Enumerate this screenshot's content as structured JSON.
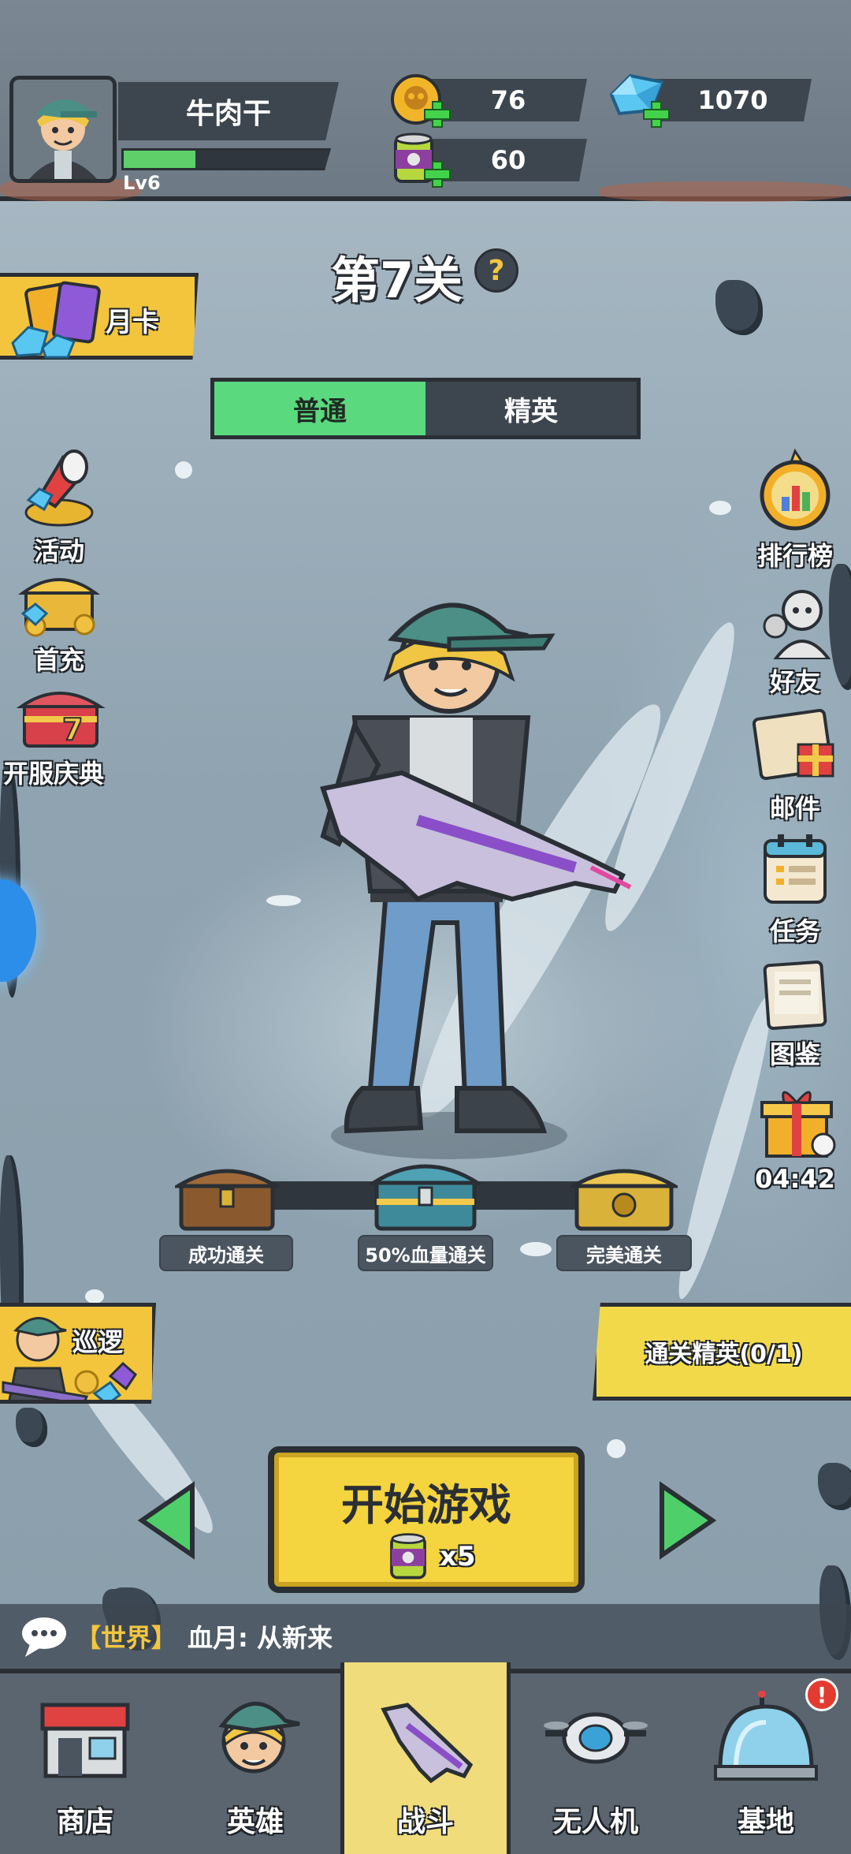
{
  "player": {
    "name": "牛肉干",
    "level": "Lv6",
    "xp_progress": 0.35
  },
  "resources": {
    "skull_coins": "76",
    "gems": "1070",
    "energy_cans": "60"
  },
  "stage": {
    "title": "第7关",
    "help_icon": "?",
    "modes": [
      "普通",
      "精英"
    ],
    "active_mode": "普通"
  },
  "left_menu": {
    "monthly_card": "月卡",
    "items": [
      {
        "label": "活动",
        "icon": "megaphone-coins-icon"
      },
      {
        "label": "首充",
        "icon": "treasure-chest-icon"
      },
      {
        "label": "开服庆典",
        "icon": "red-chest-7-icon"
      }
    ],
    "patrol": "巡逻"
  },
  "right_menu": {
    "items": [
      {
        "label": "排行榜",
        "icon": "trophy-medal-icon"
      },
      {
        "label": "好友",
        "icon": "friends-icon"
      },
      {
        "label": "邮件",
        "icon": "mail-gift-icon"
      },
      {
        "label": "任务",
        "icon": "calendar-task-icon"
      },
      {
        "label": "图鉴",
        "icon": "codex-book-icon"
      }
    ],
    "gift_timer": "04:42"
  },
  "chests": [
    {
      "label": "成功通关",
      "color": "#8a5a2e"
    },
    {
      "label": "50%血量通关",
      "color": "#3f8a9a"
    },
    {
      "label": "完美通关",
      "color": "#d9b23a"
    }
  ],
  "elite_pass": "通关精英(0/1)",
  "start_button": {
    "title": "开始游戏",
    "cost": "x5"
  },
  "chat": {
    "channel": "【世界】",
    "message": "血月: 从新来"
  },
  "bottom_nav": {
    "items": [
      "商店",
      "英雄",
      "战斗",
      "无人机",
      "基地"
    ],
    "active": "战斗",
    "badge": "!"
  },
  "colors": {
    "accent_yellow": "#f2c53c",
    "accent_green": "#5bd97f",
    "panel_dark": "#3d464f",
    "outline": "#2a2f35"
  }
}
